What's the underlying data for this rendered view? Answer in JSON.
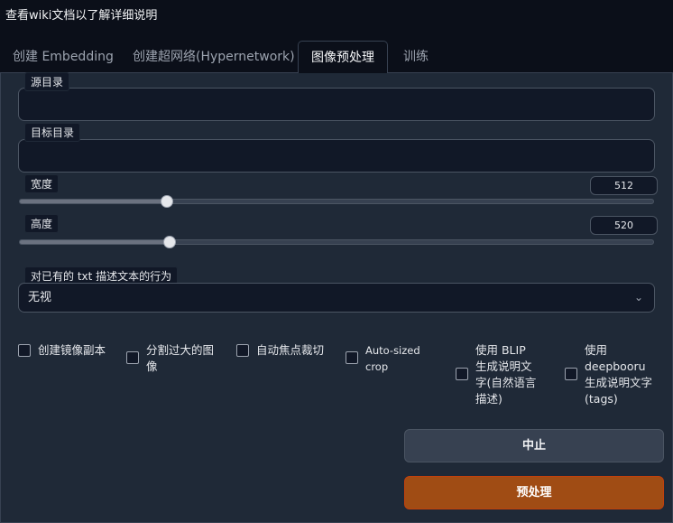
{
  "header": {
    "text": "查看wiki文档以了解详细说明"
  },
  "tabs": [
    {
      "label": "创建 Embedding",
      "active": false
    },
    {
      "label": "创建超网络(Hypernetwork)",
      "active": false
    },
    {
      "label": "图像预处理",
      "active": true
    },
    {
      "label": "训练",
      "active": false
    }
  ],
  "form": {
    "source_dir": {
      "label": "源目录",
      "value": ""
    },
    "dest_dir": {
      "label": "目标目录",
      "value": ""
    },
    "width": {
      "label": "宽度",
      "value": "512",
      "fraction": 0.232
    },
    "height": {
      "label": "高度",
      "value": "520",
      "fraction": 0.236
    },
    "caption_action": {
      "label": "对已有的 txt 描述文本的行为",
      "selected": "无视"
    },
    "checkboxes": [
      {
        "label": "创建镜像副本",
        "checked": false
      },
      {
        "label": "分割过大的图像",
        "checked": false
      },
      {
        "label": "自动焦点裁切",
        "checked": false
      },
      {
        "label": "Auto-sized crop",
        "checked": false
      },
      {
        "label": "使用 BLIP 生成说明文字(自然语言描述)",
        "checked": false
      },
      {
        "label": "使用 deepbooru 生成说明文字(tags)",
        "checked": false
      }
    ]
  },
  "buttons": {
    "stop": "中止",
    "preprocess": "预处理"
  },
  "colors": {
    "accent": "#a04c14",
    "background": "#0b0f19",
    "panel": "#1f2937"
  }
}
